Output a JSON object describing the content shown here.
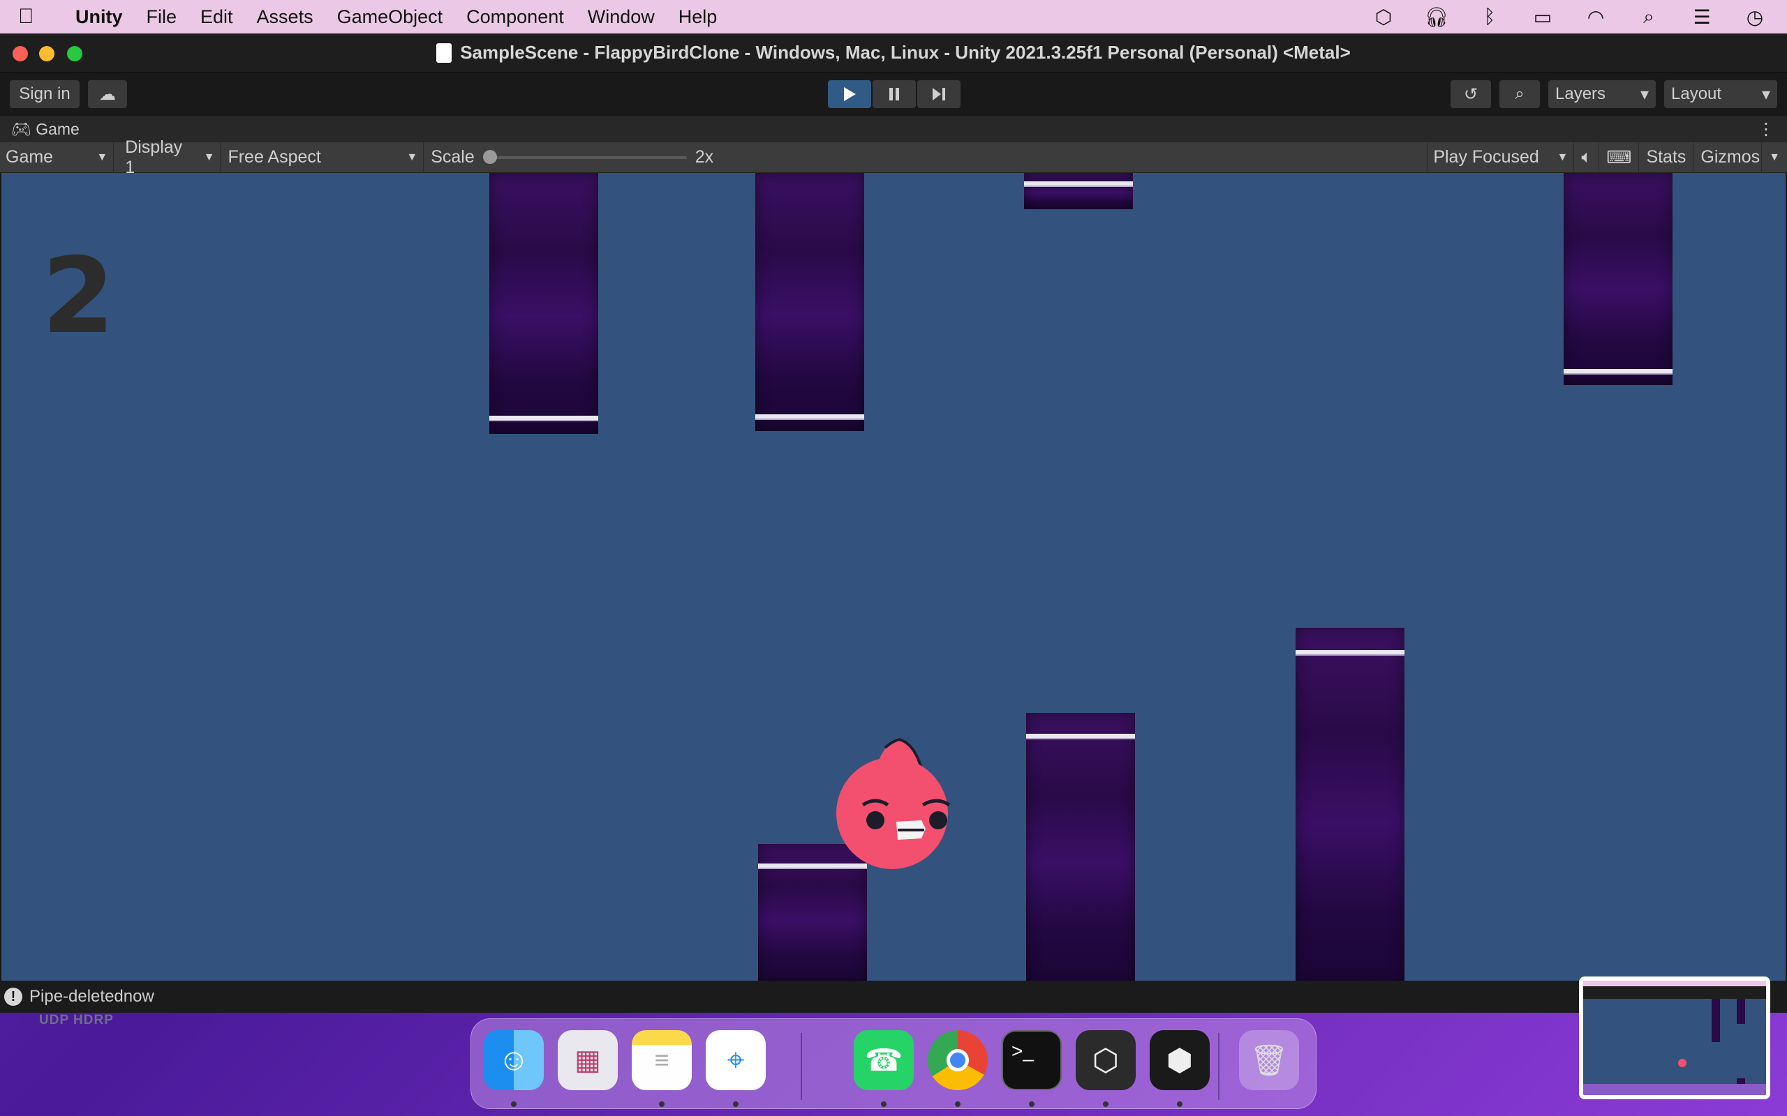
{
  "menubar": {
    "app_name": "Unity",
    "items": [
      "File",
      "Edit",
      "Assets",
      "GameObject",
      "Component",
      "Window",
      "Help"
    ]
  },
  "window": {
    "title": "SampleScene - FlappyBirdClone - Windows, Mac, Linux - Unity 2021.3.25f1 Personal (Personal) <Metal>"
  },
  "toolbar": {
    "sign_in": "Sign in",
    "layers": "Layers",
    "layout": "Layout"
  },
  "game_tab": {
    "label": "Game"
  },
  "game_controls": {
    "view_mode": "Game",
    "display": "Display 1",
    "aspect": "Free Aspect",
    "scale_label": "Scale",
    "scale_value": "2x",
    "scale_fraction": 0.0,
    "play_mode": "Play Focused",
    "stats": "Stats",
    "gizmos": "Gizmos"
  },
  "game": {
    "score": "2"
  },
  "status": {
    "message": "Pipe-deletednow"
  },
  "desktop": {
    "label": "UDP HDRP"
  },
  "dock": {
    "apps": [
      "finder",
      "launchpad",
      "notes",
      "safari",
      "whatsapp",
      "chrome",
      "terminal",
      "unity-hub",
      "unity",
      "trash"
    ]
  },
  "colors": {
    "game_bg": "#33537e",
    "pipe": "#2a0a48",
    "bird": "#f2506e",
    "play_active": "#2f5b86"
  }
}
